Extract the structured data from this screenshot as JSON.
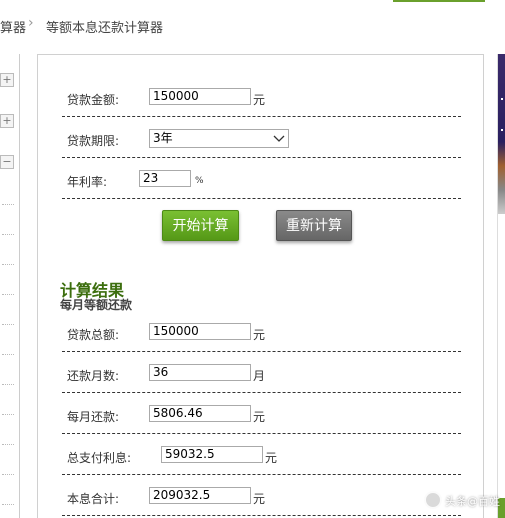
{
  "breadcrumb": {
    "prev": "算器",
    "separator": "›",
    "current": "等额本息还款计算器"
  },
  "sidebar": {
    "buttons": [
      "+",
      "+",
      "−"
    ]
  },
  "form": {
    "loan_amount": {
      "label": "贷款金额:",
      "value": "150000",
      "unit": "元"
    },
    "loan_term": {
      "label": "贷款期限:",
      "value": "3年"
    },
    "annual_rate": {
      "label": "年利率:",
      "value": "23",
      "unit": "%"
    }
  },
  "buttons": {
    "start": "开始计算",
    "reset": "重新计算"
  },
  "result": {
    "title": "计算结果",
    "subtitle": "每月等额还款",
    "rows": [
      {
        "label": "贷款总额:",
        "value": "150000",
        "unit": "元"
      },
      {
        "label": "还款月数:",
        "value": "36",
        "unit": "月"
      },
      {
        "label": "每月还款:",
        "value": "5806.46",
        "unit": "元"
      },
      {
        "label": "总支付利息:",
        "value": "59032.5",
        "unit": "元"
      },
      {
        "label": "本息合计:",
        "value": "209032.5",
        "unit": "元"
      }
    ]
  },
  "watermark": {
    "text": "头条@百姓"
  },
  "colors": {
    "accent_green": "#6aa02c",
    "title_green": "#3c6e0e",
    "reset_gray": "#777777"
  }
}
